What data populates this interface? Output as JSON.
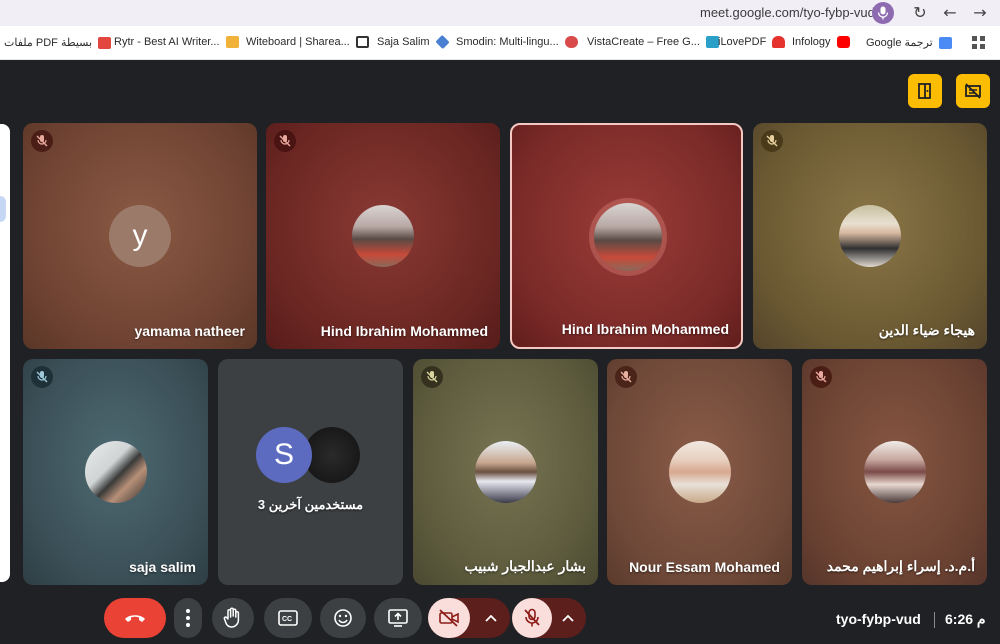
{
  "browser": {
    "url": "meet.google.com/tyo-fybp-vud",
    "bookmarks": [
      {
        "label": "ملفات PDF بسيطة",
        "icon": "pdf-icon",
        "color": "#e2463f"
      },
      {
        "label": "Rytr - Best AI Writer...",
        "icon": "rytr-icon",
        "color": "#f1b23a"
      },
      {
        "label": "Witeboard | Sharea...",
        "icon": "board-icon",
        "color": "#333333"
      },
      {
        "label": "Saja Salim",
        "icon": "diamond-icon",
        "color": "#4a7fd1"
      },
      {
        "label": "Smodin: Multi-lingu...",
        "icon": "smodin-icon",
        "color": "#d94b4b"
      },
      {
        "label": "VistaCreate – Free G...",
        "icon": "vista-icon",
        "color": "#2aa0c8"
      },
      {
        "label": "iLovePDF",
        "icon": "heart-icon",
        "color": "#e5322d"
      },
      {
        "label": "Infology",
        "icon": "youtube-icon",
        "color": "#ff0000"
      },
      {
        "label": "Google ترجمة",
        "icon": "translate-icon",
        "color": "#4a8af4"
      }
    ]
  },
  "meet": {
    "meeting_code": "tyo-fybp-vud",
    "time": "6:26 م",
    "colors": {
      "accent_yellow": "#fbbc04",
      "end_call": "#ea4335",
      "muted": "#f9dedc"
    },
    "tiles_row1": [
      {
        "name": "yamama natheer",
        "avatar_letter": "y",
        "bg": "#7a4a38"
      },
      {
        "name": "Hind Ibrahim Mohammed",
        "bg": "#6e2e2a"
      },
      {
        "name": "Hind Ibrahim Mohammed",
        "bg": "#7a2e2c"
      },
      {
        "name": "هيجاء ضياء الدين",
        "bg": "#6a5a32"
      }
    ],
    "tiles_row2": [
      {
        "name": "saja salim",
        "bg": "#3e5258"
      },
      {
        "name": "3 مستخدمين آخرين",
        "avatar_letter": "S",
        "bg": "#3c4043"
      },
      {
        "name": "بشار عبدالجبار شبيب",
        "bg": "#5c5a3c"
      },
      {
        "name": "Nour Essam Mohamed",
        "bg": "#6e4838"
      },
      {
        "name": "أ.م.د. إسراء إبراهيم محمد",
        "bg": "#6a4232"
      }
    ]
  }
}
